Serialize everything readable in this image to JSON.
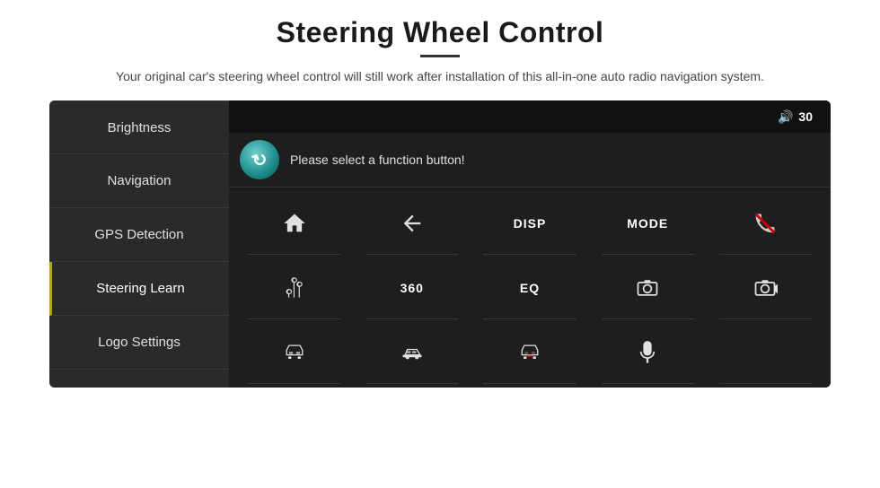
{
  "header": {
    "title": "Steering Wheel Control",
    "divider": true,
    "subtitle": "Your original car's steering wheel control will still work after installation of this all-in-one auto radio navigation system."
  },
  "topbar": {
    "volume_icon": "🔊",
    "volume_value": "30"
  },
  "sidebar": {
    "items": [
      {
        "label": "Brightness",
        "active": false
      },
      {
        "label": "Navigation",
        "active": false
      },
      {
        "label": "GPS Detection",
        "active": false
      },
      {
        "label": "Steering Learn",
        "active": true
      },
      {
        "label": "Logo Settings",
        "active": false
      }
    ]
  },
  "function_area": {
    "prompt": "Please select a function button!",
    "refresh_title": "refresh"
  },
  "grid": {
    "rows": [
      [
        {
          "type": "home",
          "label": ""
        },
        {
          "type": "back",
          "label": ""
        },
        {
          "type": "text",
          "label": "DISP"
        },
        {
          "type": "text",
          "label": "MODE"
        },
        {
          "type": "no-call",
          "label": ""
        }
      ],
      [
        {
          "type": "tune",
          "label": ""
        },
        {
          "type": "text",
          "label": "360"
        },
        {
          "type": "text",
          "label": "EQ"
        },
        {
          "type": "camera",
          "label": ""
        },
        {
          "type": "camera2",
          "label": ""
        }
      ],
      [
        {
          "type": "car-front",
          "label": ""
        },
        {
          "type": "car-side",
          "label": ""
        },
        {
          "type": "car-back",
          "label": ""
        },
        {
          "type": "mic",
          "label": ""
        },
        {
          "type": "empty",
          "label": ""
        }
      ]
    ]
  }
}
